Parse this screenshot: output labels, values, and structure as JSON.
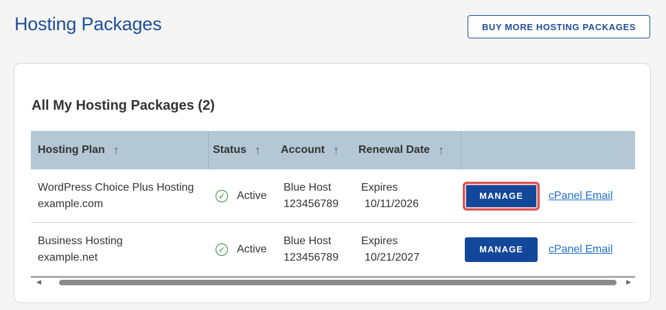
{
  "header": {
    "title": "Hosting Packages",
    "buy_button": "BUY MORE HOSTING PACKAGES"
  },
  "section": {
    "title": "All My Hosting Packages (2)"
  },
  "table": {
    "columns": [
      "Hosting Plan",
      "Status",
      "Account",
      "Renewal Date",
      ""
    ],
    "rows": [
      {
        "plan": "WordPress Choice Plus Hosting",
        "domain": "example.com",
        "status": "Active",
        "account_provider": "Blue Host",
        "account_number": "123456789",
        "renewal_label": "Expires",
        "renewal_date": "10/11/2026",
        "manage_label": "MANAGE",
        "email_link": "cPanel Email"
      },
      {
        "plan": "Business Hosting",
        "domain": "example.net",
        "status": "Active",
        "account_provider": "Blue Host",
        "account_number": "123456789",
        "renewal_label": "Expires",
        "renewal_date": "10/21/2027",
        "manage_label": "MANAGE",
        "email_link": "cPanel Email"
      }
    ]
  },
  "icons": {
    "sort": "arrow-up-icon",
    "status": "check-circle-icon",
    "scroll_left": "triangle-left-icon",
    "scroll_right": "triangle-right-icon"
  },
  "colors": {
    "brand": "#1f4e9a",
    "header_bg": "#b3c7d4",
    "manage_bg": "#13479a",
    "active_green": "#2e8b3a",
    "highlight": "#d9534f"
  }
}
